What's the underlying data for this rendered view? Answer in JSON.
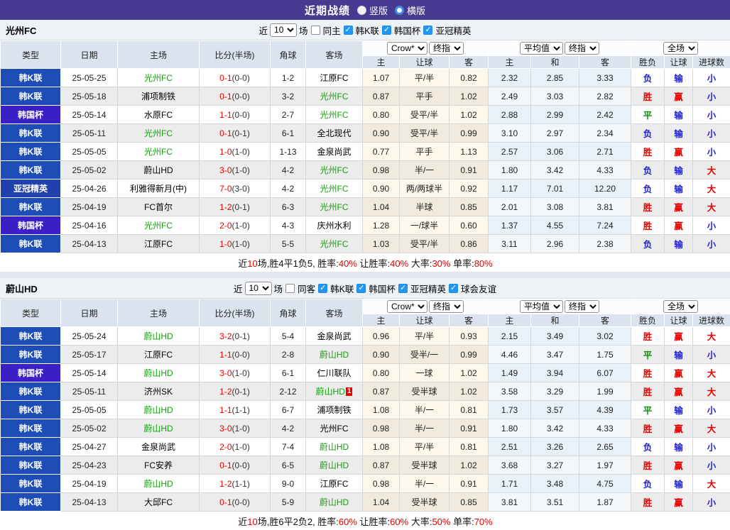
{
  "header": {
    "title": "近期战绩",
    "radio_vertical": "竖版",
    "radio_horizontal": "横版"
  },
  "colors": {
    "accent_purple": "#473a91",
    "focus_team_green": "#13a10e",
    "score_red": "#e60000",
    "win_red": "#e60000",
    "draw_green": "#0a8f0a",
    "loss_blue": "#2323d6",
    "types": {
      "韩K联": "#1e4db7",
      "韩国杯": "#3a1fc6",
      "亚冠精英": "#2040ae"
    }
  },
  "sections": [
    {
      "team": "光州FC",
      "filter": {
        "near": "近",
        "count": "10",
        "games": "场",
        "same": "同主",
        "leagues": [
          "韩K联",
          "韩国杯",
          "亚冠精英"
        ]
      },
      "columns": {
        "type": "类型",
        "date": "日期",
        "home": "主场",
        "score": "比分(半场)",
        "corner": "角球",
        "away": "客场"
      },
      "dropdowns": {
        "odds_source": "Crow*",
        "odds_time": "终指",
        "avg_source": "平均值",
        "avg_time": "终指",
        "scope": "全场"
      },
      "sub_headers": [
        "主",
        "让球",
        "客",
        "主",
        "和",
        "客",
        "胜负",
        "让球",
        "进球数"
      ],
      "rows": [
        {
          "t": "韩K联",
          "d": "25-05-25",
          "h": "光州FC",
          "hf": true,
          "s": "0-1",
          "hs": "(0-0)",
          "c": "1-2",
          "a": "江原FC",
          "af": false,
          "o1": "1.07",
          "hd": "平/半",
          "o2": "0.82",
          "a1": "2.32",
          "a2": "2.85",
          "a3": "3.33",
          "r1": "负",
          "r1c": "loss",
          "r2": "输",
          "r2c": "loss",
          "r3": "小",
          "r3c": "loss"
        },
        {
          "t": "韩K联",
          "d": "25-05-18",
          "h": "浦项制铁",
          "hf": false,
          "s": "0-1",
          "hs": "(0-0)",
          "c": "3-2",
          "a": "光州FC",
          "af": true,
          "o1": "0.87",
          "hd": "平手",
          "o2": "1.02",
          "a1": "2.49",
          "a2": "3.03",
          "a3": "2.82",
          "r1": "胜",
          "r1c": "win",
          "r2": "赢",
          "r2c": "win",
          "r3": "小",
          "r3c": "loss"
        },
        {
          "t": "韩国杯",
          "d": "25-05-14",
          "h": "水原FC",
          "hf": false,
          "s": "1-1",
          "hs": "(0-0)",
          "c": "2-7",
          "a": "光州FC",
          "af": true,
          "o1": "0.80",
          "hd": "受平/半",
          "o2": "1.02",
          "a1": "2.88",
          "a2": "2.99",
          "a3": "2.42",
          "r1": "平",
          "r1c": "draw",
          "r2": "输",
          "r2c": "loss",
          "r3": "小",
          "r3c": "loss"
        },
        {
          "t": "韩K联",
          "d": "25-05-11",
          "h": "光州FC",
          "hf": true,
          "s": "0-1",
          "hs": "(0-1)",
          "c": "6-1",
          "a": "全北现代",
          "af": false,
          "o1": "0.90",
          "hd": "受平/半",
          "o2": "0.99",
          "a1": "3.10",
          "a2": "2.97",
          "a3": "2.34",
          "r1": "负",
          "r1c": "loss",
          "r2": "输",
          "r2c": "loss",
          "r3": "小",
          "r3c": "loss"
        },
        {
          "t": "韩K联",
          "d": "25-05-05",
          "h": "光州FC",
          "hf": true,
          "s": "1-0",
          "hs": "(1-0)",
          "c": "1-13",
          "a": "金泉尚武",
          "af": false,
          "o1": "0.77",
          "hd": "平手",
          "o2": "1.13",
          "a1": "2.57",
          "a2": "3.06",
          "a3": "2.71",
          "r1": "胜",
          "r1c": "win",
          "r2": "赢",
          "r2c": "win",
          "r3": "小",
          "r3c": "loss"
        },
        {
          "t": "韩K联",
          "d": "25-05-02",
          "h": "蔚山HD",
          "hf": false,
          "s": "3-0",
          "hs": "(1-0)",
          "c": "4-2",
          "a": "光州FC",
          "af": true,
          "o1": "0.98",
          "hd": "半/一",
          "o2": "0.91",
          "a1": "1.80",
          "a2": "3.42",
          "a3": "4.33",
          "r1": "负",
          "r1c": "loss",
          "r2": "输",
          "r2c": "loss",
          "r3": "大",
          "r3c": "win"
        },
        {
          "t": "亚冠精英",
          "d": "25-04-26",
          "h": "利雅得新月(中)",
          "hf": false,
          "s": "7-0",
          "hs": "(3-0)",
          "c": "4-2",
          "a": "光州FC",
          "af": true,
          "o1": "0.90",
          "hd": "两/两球半",
          "o2": "0.92",
          "a1": "1.17",
          "a2": "7.01",
          "a3": "12.20",
          "r1": "负",
          "r1c": "loss",
          "r2": "输",
          "r2c": "loss",
          "r3": "大",
          "r3c": "win"
        },
        {
          "t": "韩K联",
          "d": "25-04-19",
          "h": "FC首尔",
          "hf": false,
          "s": "1-2",
          "hs": "(0-1)",
          "c": "6-3",
          "a": "光州FC",
          "af": true,
          "o1": "1.04",
          "hd": "半球",
          "o2": "0.85",
          "a1": "2.01",
          "a2": "3.08",
          "a3": "3.81",
          "r1": "胜",
          "r1c": "win",
          "r2": "赢",
          "r2c": "win",
          "r3": "大",
          "r3c": "win"
        },
        {
          "t": "韩国杯",
          "d": "25-04-16",
          "h": "光州FC",
          "hf": true,
          "s": "2-0",
          "hs": "(1-0)",
          "c": "4-3",
          "a": "庆州水利",
          "af": false,
          "o1": "1.28",
          "hd": "一/球半",
          "o2": "0.60",
          "a1": "1.37",
          "a2": "4.55",
          "a3": "7.24",
          "r1": "胜",
          "r1c": "win",
          "r2": "赢",
          "r2c": "win",
          "r3": "小",
          "r3c": "loss"
        },
        {
          "t": "韩K联",
          "d": "25-04-13",
          "h": "江原FC",
          "hf": false,
          "s": "1-0",
          "hs": "(1-0)",
          "c": "5-5",
          "a": "光州FC",
          "af": true,
          "o1": "1.03",
          "hd": "受平/半",
          "o2": "0.86",
          "a1": "3.11",
          "a2": "2.96",
          "a3": "2.38",
          "r1": "负",
          "r1c": "loss",
          "r2": "输",
          "r2c": "loss",
          "r3": "小",
          "r3c": "loss"
        }
      ],
      "summary": [
        {
          "t": "近"
        },
        {
          "t": "10",
          "red": true
        },
        {
          "t": "场,胜4平1负5, 胜率:"
        },
        {
          "t": "40%",
          "red": true
        },
        {
          "t": " 让胜率:"
        },
        {
          "t": "40%",
          "red": true
        },
        {
          "t": " 大率:"
        },
        {
          "t": "30%",
          "red": true
        },
        {
          "t": " 单率:"
        },
        {
          "t": "80%",
          "red": true
        }
      ]
    },
    {
      "team": "蔚山HD",
      "filter": {
        "near": "近",
        "count": "10",
        "games": "场",
        "same": "同客",
        "leagues": [
          "韩K联",
          "韩国杯",
          "亚冠精英",
          "球会友谊"
        ]
      },
      "columns": {
        "type": "类型",
        "date": "日期",
        "home": "主场",
        "score": "比分(半场)",
        "corner": "角球",
        "away": "客场"
      },
      "dropdowns": {
        "odds_source": "Crow*",
        "odds_time": "终指",
        "avg_source": "平均值",
        "avg_time": "终指",
        "scope": "全场"
      },
      "sub_headers": [
        "主",
        "让球",
        "客",
        "主",
        "和",
        "客",
        "胜负",
        "让球",
        "进球数"
      ],
      "rows": [
        {
          "t": "韩K联",
          "d": "25-05-24",
          "h": "蔚山HD",
          "hf": true,
          "s": "3-2",
          "hs": "(0-1)",
          "c": "5-4",
          "a": "金泉尚武",
          "af": false,
          "o1": "0.96",
          "hd": "平/半",
          "o2": "0.93",
          "a1": "2.15",
          "a2": "3.49",
          "a3": "3.02",
          "r1": "胜",
          "r1c": "win",
          "r2": "赢",
          "r2c": "win",
          "r3": "大",
          "r3c": "win"
        },
        {
          "t": "韩K联",
          "d": "25-05-17",
          "h": "江原FC",
          "hf": false,
          "s": "1-1",
          "hs": "(0-0)",
          "c": "2-8",
          "a": "蔚山HD",
          "af": true,
          "o1": "0.90",
          "hd": "受半/一",
          "o2": "0.99",
          "a1": "4.46",
          "a2": "3.47",
          "a3": "1.75",
          "r1": "平",
          "r1c": "draw",
          "r2": "输",
          "r2c": "loss",
          "r3": "小",
          "r3c": "loss"
        },
        {
          "t": "韩国杯",
          "d": "25-05-14",
          "h": "蔚山HD",
          "hf": true,
          "s": "3-0",
          "hs": "(1-0)",
          "c": "6-1",
          "a": "仁川联队",
          "af": false,
          "o1": "0.80",
          "hd": "一球",
          "o2": "1.02",
          "a1": "1.49",
          "a2": "3.94",
          "a3": "6.07",
          "r1": "胜",
          "r1c": "win",
          "r2": "赢",
          "r2c": "win",
          "r3": "大",
          "r3c": "win"
        },
        {
          "t": "韩K联",
          "d": "25-05-11",
          "h": "济州SK",
          "hf": false,
          "s": "1-2",
          "hs": "(0-1)",
          "c": "2-12",
          "a": "蔚山HD",
          "af": true,
          "asup": "1",
          "o1": "0.87",
          "hd": "受半球",
          "o2": "1.02",
          "a1": "3.58",
          "a2": "3.29",
          "a3": "1.99",
          "r1": "胜",
          "r1c": "win",
          "r2": "赢",
          "r2c": "win",
          "r3": "大",
          "r3c": "win"
        },
        {
          "t": "韩K联",
          "d": "25-05-05",
          "h": "蔚山HD",
          "hf": true,
          "s": "1-1",
          "hs": "(1-1)",
          "c": "6-7",
          "a": "浦项制铁",
          "af": false,
          "o1": "1.08",
          "hd": "半/一",
          "o2": "0.81",
          "a1": "1.73",
          "a2": "3.57",
          "a3": "4.39",
          "r1": "平",
          "r1c": "draw",
          "r2": "输",
          "r2c": "loss",
          "r3": "小",
          "r3c": "loss"
        },
        {
          "t": "韩K联",
          "d": "25-05-02",
          "h": "蔚山HD",
          "hf": true,
          "s": "3-0",
          "hs": "(1-0)",
          "c": "4-2",
          "a": "光州FC",
          "af": false,
          "o1": "0.98",
          "hd": "半/一",
          "o2": "0.91",
          "a1": "1.80",
          "a2": "3.42",
          "a3": "4.33",
          "r1": "胜",
          "r1c": "win",
          "r2": "赢",
          "r2c": "win",
          "r3": "大",
          "r3c": "win"
        },
        {
          "t": "韩K联",
          "d": "25-04-27",
          "h": "金泉尚武",
          "hf": false,
          "s": "2-0",
          "hs": "(1-0)",
          "c": "7-4",
          "a": "蔚山HD",
          "af": true,
          "o1": "1.08",
          "hd": "平/半",
          "o2": "0.81",
          "a1": "2.51",
          "a2": "3.26",
          "a3": "2.65",
          "r1": "负",
          "r1c": "loss",
          "r2": "输",
          "r2c": "loss",
          "r3": "小",
          "r3c": "loss"
        },
        {
          "t": "韩K联",
          "d": "25-04-23",
          "h": "FC安养",
          "hf": false,
          "s": "0-1",
          "hs": "(0-0)",
          "c": "6-5",
          "a": "蔚山HD",
          "af": true,
          "o1": "0.87",
          "hd": "受半球",
          "o2": "1.02",
          "a1": "3.68",
          "a2": "3.27",
          "a3": "1.97",
          "r1": "胜",
          "r1c": "win",
          "r2": "赢",
          "r2c": "win",
          "r3": "小",
          "r3c": "loss"
        },
        {
          "t": "韩K联",
          "d": "25-04-19",
          "h": "蔚山HD",
          "hf": true,
          "s": "1-2",
          "hs": "(1-1)",
          "c": "9-0",
          "a": "江原FC",
          "af": false,
          "o1": "0.98",
          "hd": "半/一",
          "o2": "0.91",
          "a1": "1.71",
          "a2": "3.48",
          "a3": "4.75",
          "r1": "负",
          "r1c": "loss",
          "r2": "输",
          "r2c": "loss",
          "r3": "大",
          "r3c": "win"
        },
        {
          "t": "韩K联",
          "d": "25-04-13",
          "h": "大邱FC",
          "hf": false,
          "s": "0-1",
          "hs": "(0-0)",
          "c": "5-9",
          "a": "蔚山HD",
          "af": true,
          "o1": "1.04",
          "hd": "受半球",
          "o2": "0.85",
          "a1": "3.81",
          "a2": "3.51",
          "a3": "1.87",
          "r1": "胜",
          "r1c": "win",
          "r2": "赢",
          "r2c": "win",
          "r3": "小",
          "r3c": "loss"
        }
      ],
      "summary": [
        {
          "t": "近"
        },
        {
          "t": "10",
          "red": true
        },
        {
          "t": "场,胜6平2负2, 胜率:"
        },
        {
          "t": "60%",
          "red": true
        },
        {
          "t": " 让胜率:"
        },
        {
          "t": "60%",
          "red": true
        },
        {
          "t": " 大率:"
        },
        {
          "t": "50%",
          "red": true
        },
        {
          "t": " 单率:"
        },
        {
          "t": "70%",
          "red": true
        }
      ]
    }
  ]
}
